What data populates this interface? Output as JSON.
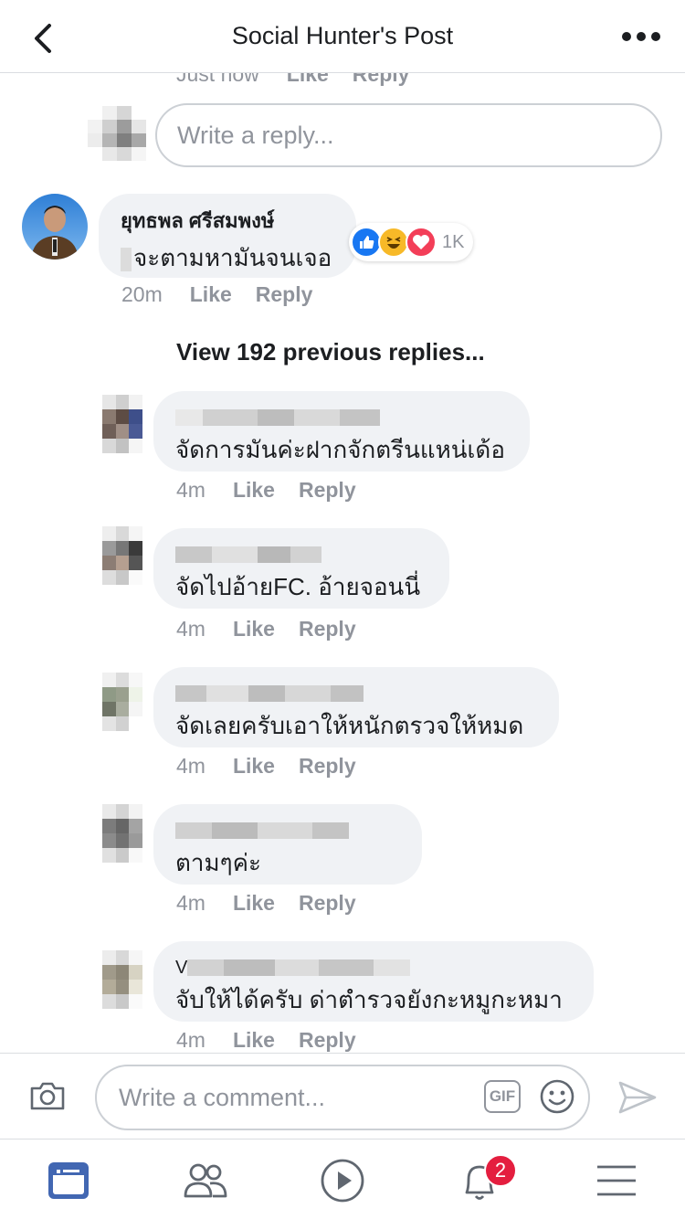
{
  "header": {
    "title": "Social Hunter's Post"
  },
  "top_reply": {
    "time": "Just now",
    "like": "Like",
    "reply": "Reply"
  },
  "reply_box": {
    "placeholder": "Write a reply..."
  },
  "main_comment": {
    "author": "ยุทธพล ศรีสมพงษ์",
    "text": "จะตามหามันจนเจอ",
    "time": "20m",
    "like": "Like",
    "reply": "Reply",
    "reactions": [
      "like",
      "haha",
      "love"
    ],
    "reaction_count": "1K"
  },
  "view_previous": "View 192 previous replies...",
  "replies": [
    {
      "text": "จัดการมันค่ะฝากจักตรีนแหน่เด้อ",
      "time": "4m",
      "like": "Like",
      "reply": "Reply"
    },
    {
      "text": "จัดไปอ้ายFC. อ้ายจอนนี่",
      "time": "4m",
      "like": "Like",
      "reply": "Reply"
    },
    {
      "text": "จัดเลยครับเอาให้หนักตรวจให้หมด",
      "time": "4m",
      "like": "Like",
      "reply": "Reply"
    },
    {
      "text": "ตามๆค่ะ",
      "time": "4m",
      "like": "Like",
      "reply": "Reply"
    },
    {
      "name_initial": "V",
      "text": "จับให้ได้ครับ ด่าตำรวจยังกะหมูกะหมา",
      "time": "4m",
      "like": "Like",
      "reply": "Reply"
    }
  ],
  "composer": {
    "placeholder": "Write a comment...",
    "gif": "GIF"
  },
  "tabbar": {
    "notifications_badge": "2"
  },
  "colors": {
    "accent": "#4267b2",
    "bubble": "#f0f2f5",
    "meta": "#90949c",
    "badge": "#e41e3f"
  }
}
